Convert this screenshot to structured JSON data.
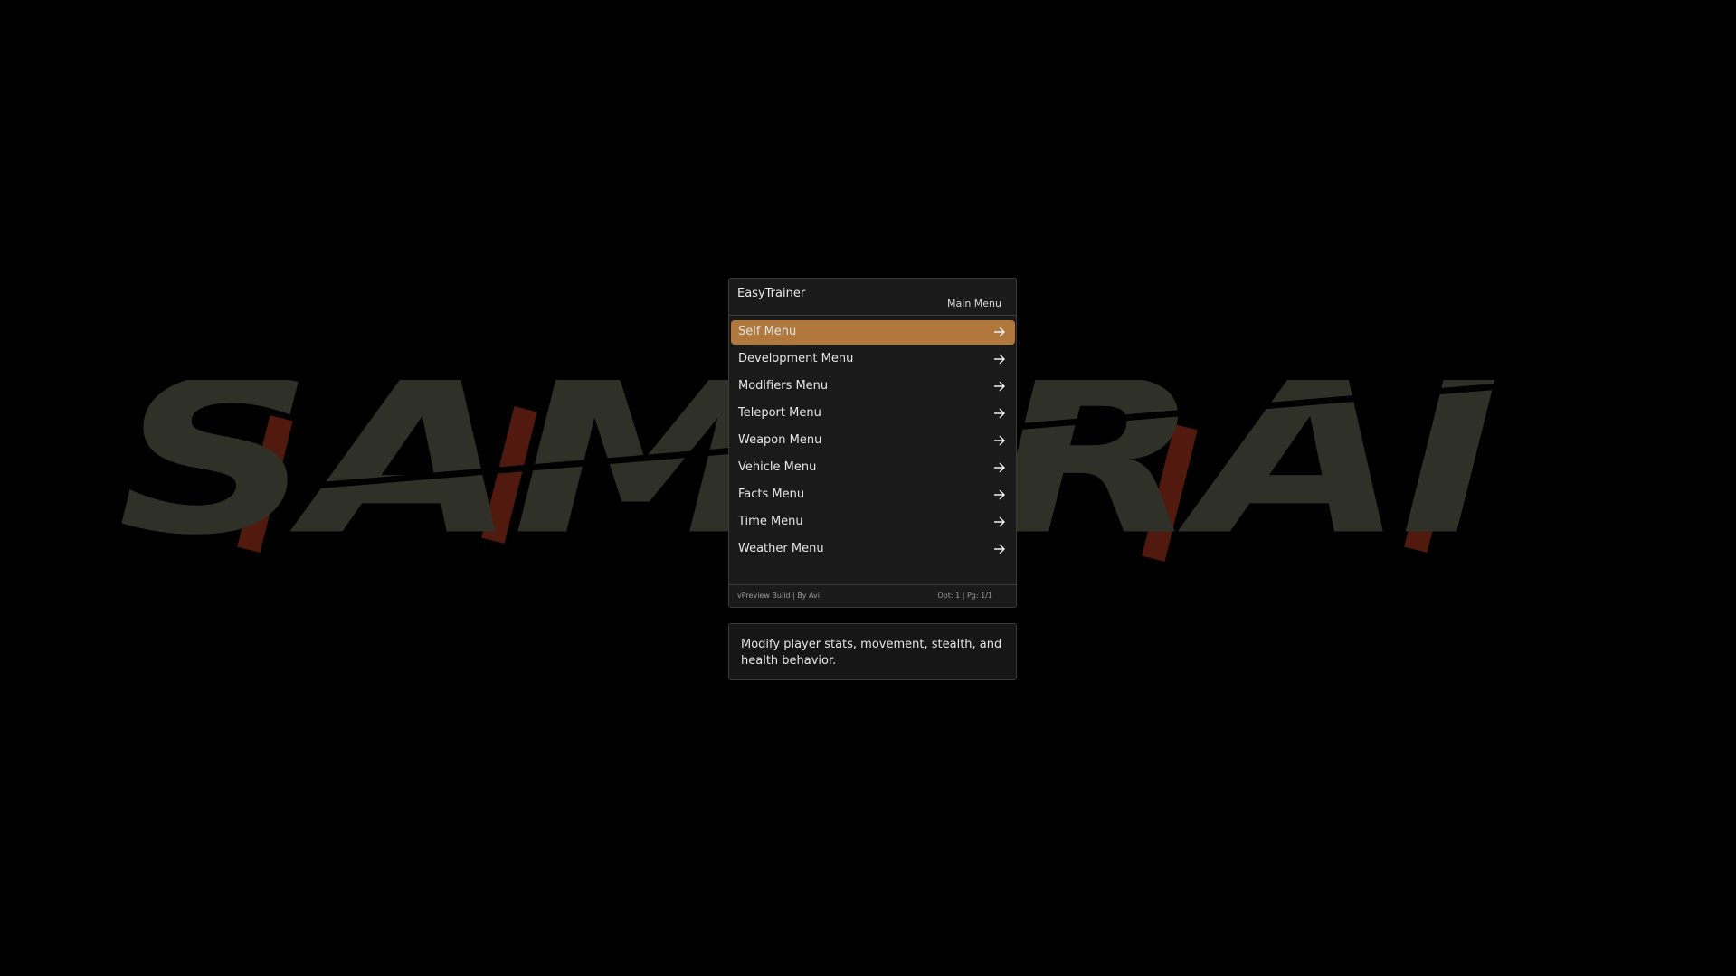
{
  "background": {
    "logo_text": "SAMURAI"
  },
  "menu": {
    "title": "EasyTrainer",
    "subtitle": "Main Menu",
    "accent_color": "#b0783c",
    "items": [
      {
        "label": "Self Menu",
        "icon": "arrow-right-icon",
        "selected": true
      },
      {
        "label": "Development Menu",
        "icon": "arrow-right-icon",
        "selected": false
      },
      {
        "label": "Modifiers Menu",
        "icon": "arrow-right-icon",
        "selected": false
      },
      {
        "label": "Teleport Menu",
        "icon": "arrow-right-icon",
        "selected": false
      },
      {
        "label": "Weapon Menu",
        "icon": "arrow-right-icon",
        "selected": false
      },
      {
        "label": "Vehicle Menu",
        "icon": "arrow-right-icon",
        "selected": false
      },
      {
        "label": "Facts Menu",
        "icon": "arrow-right-icon",
        "selected": false
      },
      {
        "label": "Time Menu",
        "icon": "arrow-right-icon",
        "selected": false
      },
      {
        "label": "Weather Menu",
        "icon": "arrow-right-icon",
        "selected": false
      }
    ],
    "footer": {
      "build": "vPreview Build | By Avi",
      "position": "Opt: 1 | Pg: 1/1"
    }
  },
  "description": {
    "text": "Modify player stats, movement, stealth, and health behavior."
  }
}
